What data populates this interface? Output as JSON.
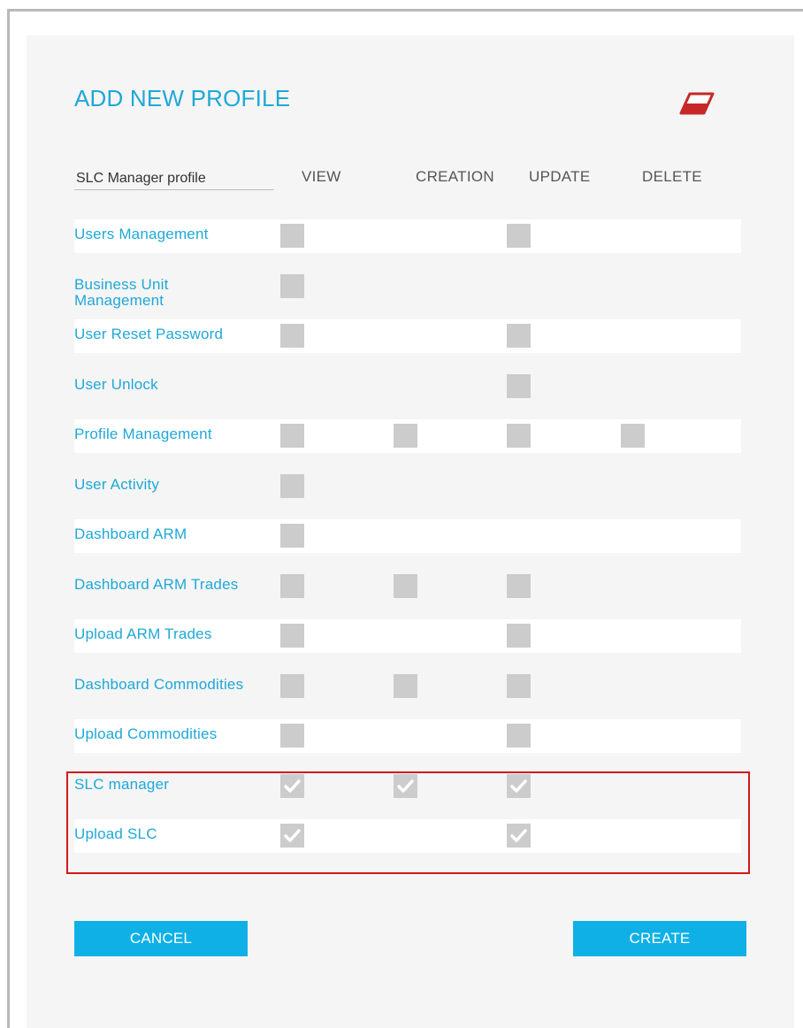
{
  "dialog": {
    "title": "ADD NEW PROFILE",
    "clear_icon": "eraser-icon",
    "profile_name": "SLC Manager profile"
  },
  "columns": [
    "VIEW",
    "CREATION",
    "UPDATE",
    "DELETE"
  ],
  "rows": [
    {
      "label": "Users Management",
      "view": "unchecked",
      "creation": null,
      "update": "unchecked",
      "delete": null
    },
    {
      "label": "Business Unit Management",
      "view": "unchecked",
      "creation": null,
      "update": null,
      "delete": null
    },
    {
      "label": "User Reset Password",
      "view": "unchecked",
      "creation": null,
      "update": "unchecked",
      "delete": null
    },
    {
      "label": "User Unlock",
      "view": null,
      "creation": null,
      "update": "unchecked",
      "delete": null
    },
    {
      "label": "Profile Management",
      "view": "unchecked",
      "creation": "unchecked",
      "update": "unchecked",
      "delete": "unchecked"
    },
    {
      "label": "User Activity",
      "view": "unchecked",
      "creation": null,
      "update": null,
      "delete": null
    },
    {
      "label": "Dashboard ARM",
      "view": "unchecked",
      "creation": null,
      "update": null,
      "delete": null
    },
    {
      "label": "Dashboard ARM Trades",
      "view": "unchecked",
      "creation": "unchecked",
      "update": "unchecked",
      "delete": null
    },
    {
      "label": "Upload ARM Trades",
      "view": "unchecked",
      "creation": null,
      "update": "unchecked",
      "delete": null
    },
    {
      "label": "Dashboard Commodities",
      "view": "unchecked",
      "creation": "unchecked",
      "update": "unchecked",
      "delete": null
    },
    {
      "label": "Upload Commodities",
      "view": "unchecked",
      "creation": null,
      "update": "unchecked",
      "delete": null
    },
    {
      "label": "SLC manager",
      "view": "checked",
      "creation": "checked",
      "update": "checked",
      "delete": null
    },
    {
      "label": "Upload SLC",
      "view": "checked",
      "creation": null,
      "update": "checked",
      "delete": null
    }
  ],
  "highlight_color": "#d11a1a",
  "accent_color": "#1fa8d7",
  "buttons": {
    "cancel": "CANCEL",
    "create": "CREATE"
  }
}
